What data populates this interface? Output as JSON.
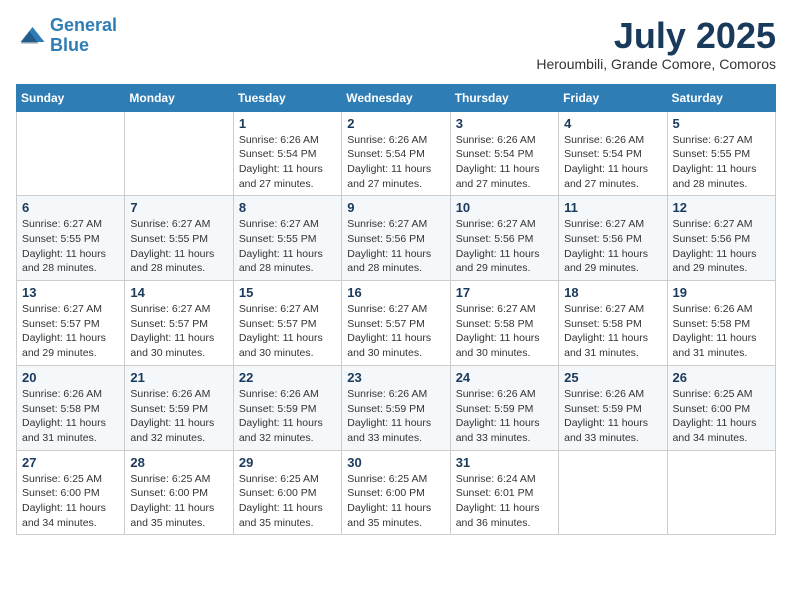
{
  "header": {
    "logo_line1": "General",
    "logo_line2": "Blue",
    "month_title": "July 2025",
    "location": "Heroumbili, Grande Comore, Comoros"
  },
  "weekdays": [
    "Sunday",
    "Monday",
    "Tuesday",
    "Wednesday",
    "Thursday",
    "Friday",
    "Saturday"
  ],
  "weeks": [
    [
      {
        "day": "",
        "info": ""
      },
      {
        "day": "",
        "info": ""
      },
      {
        "day": "1",
        "info": "Sunrise: 6:26 AM\nSunset: 5:54 PM\nDaylight: 11 hours and 27 minutes."
      },
      {
        "day": "2",
        "info": "Sunrise: 6:26 AM\nSunset: 5:54 PM\nDaylight: 11 hours and 27 minutes."
      },
      {
        "day": "3",
        "info": "Sunrise: 6:26 AM\nSunset: 5:54 PM\nDaylight: 11 hours and 27 minutes."
      },
      {
        "day": "4",
        "info": "Sunrise: 6:26 AM\nSunset: 5:54 PM\nDaylight: 11 hours and 27 minutes."
      },
      {
        "day": "5",
        "info": "Sunrise: 6:27 AM\nSunset: 5:55 PM\nDaylight: 11 hours and 28 minutes."
      }
    ],
    [
      {
        "day": "6",
        "info": "Sunrise: 6:27 AM\nSunset: 5:55 PM\nDaylight: 11 hours and 28 minutes."
      },
      {
        "day": "7",
        "info": "Sunrise: 6:27 AM\nSunset: 5:55 PM\nDaylight: 11 hours and 28 minutes."
      },
      {
        "day": "8",
        "info": "Sunrise: 6:27 AM\nSunset: 5:55 PM\nDaylight: 11 hours and 28 minutes."
      },
      {
        "day": "9",
        "info": "Sunrise: 6:27 AM\nSunset: 5:56 PM\nDaylight: 11 hours and 28 minutes."
      },
      {
        "day": "10",
        "info": "Sunrise: 6:27 AM\nSunset: 5:56 PM\nDaylight: 11 hours and 29 minutes."
      },
      {
        "day": "11",
        "info": "Sunrise: 6:27 AM\nSunset: 5:56 PM\nDaylight: 11 hours and 29 minutes."
      },
      {
        "day": "12",
        "info": "Sunrise: 6:27 AM\nSunset: 5:56 PM\nDaylight: 11 hours and 29 minutes."
      }
    ],
    [
      {
        "day": "13",
        "info": "Sunrise: 6:27 AM\nSunset: 5:57 PM\nDaylight: 11 hours and 29 minutes."
      },
      {
        "day": "14",
        "info": "Sunrise: 6:27 AM\nSunset: 5:57 PM\nDaylight: 11 hours and 30 minutes."
      },
      {
        "day": "15",
        "info": "Sunrise: 6:27 AM\nSunset: 5:57 PM\nDaylight: 11 hours and 30 minutes."
      },
      {
        "day": "16",
        "info": "Sunrise: 6:27 AM\nSunset: 5:57 PM\nDaylight: 11 hours and 30 minutes."
      },
      {
        "day": "17",
        "info": "Sunrise: 6:27 AM\nSunset: 5:58 PM\nDaylight: 11 hours and 30 minutes."
      },
      {
        "day": "18",
        "info": "Sunrise: 6:27 AM\nSunset: 5:58 PM\nDaylight: 11 hours and 31 minutes."
      },
      {
        "day": "19",
        "info": "Sunrise: 6:26 AM\nSunset: 5:58 PM\nDaylight: 11 hours and 31 minutes."
      }
    ],
    [
      {
        "day": "20",
        "info": "Sunrise: 6:26 AM\nSunset: 5:58 PM\nDaylight: 11 hours and 31 minutes."
      },
      {
        "day": "21",
        "info": "Sunrise: 6:26 AM\nSunset: 5:59 PM\nDaylight: 11 hours and 32 minutes."
      },
      {
        "day": "22",
        "info": "Sunrise: 6:26 AM\nSunset: 5:59 PM\nDaylight: 11 hours and 32 minutes."
      },
      {
        "day": "23",
        "info": "Sunrise: 6:26 AM\nSunset: 5:59 PM\nDaylight: 11 hours and 33 minutes."
      },
      {
        "day": "24",
        "info": "Sunrise: 6:26 AM\nSunset: 5:59 PM\nDaylight: 11 hours and 33 minutes."
      },
      {
        "day": "25",
        "info": "Sunrise: 6:26 AM\nSunset: 5:59 PM\nDaylight: 11 hours and 33 minutes."
      },
      {
        "day": "26",
        "info": "Sunrise: 6:25 AM\nSunset: 6:00 PM\nDaylight: 11 hours and 34 minutes."
      }
    ],
    [
      {
        "day": "27",
        "info": "Sunrise: 6:25 AM\nSunset: 6:00 PM\nDaylight: 11 hours and 34 minutes."
      },
      {
        "day": "28",
        "info": "Sunrise: 6:25 AM\nSunset: 6:00 PM\nDaylight: 11 hours and 35 minutes."
      },
      {
        "day": "29",
        "info": "Sunrise: 6:25 AM\nSunset: 6:00 PM\nDaylight: 11 hours and 35 minutes."
      },
      {
        "day": "30",
        "info": "Sunrise: 6:25 AM\nSunset: 6:00 PM\nDaylight: 11 hours and 35 minutes."
      },
      {
        "day": "31",
        "info": "Sunrise: 6:24 AM\nSunset: 6:01 PM\nDaylight: 11 hours and 36 minutes."
      },
      {
        "day": "",
        "info": ""
      },
      {
        "day": "",
        "info": ""
      }
    ]
  ]
}
